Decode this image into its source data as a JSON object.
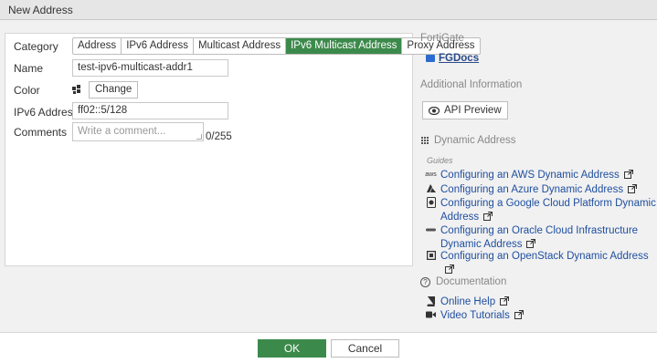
{
  "window": {
    "title": "New Address"
  },
  "form": {
    "category_label": "Category",
    "category_options": [
      "Address",
      "IPv6 Address",
      "Multicast Address",
      "IPv6 Multicast Address",
      "Proxy Address"
    ],
    "category_selected": "IPv6 Multicast Address",
    "name_label": "Name",
    "name_value": "test-ipv6-multicast-addr1",
    "color_label": "Color",
    "change_label": "Change",
    "ipv6_label": "IPv6 Address",
    "ipv6_value": "ff02::5/128",
    "comments_label": "Comments",
    "comments_placeholder": "Write a comment...",
    "comments_counter": "0/255"
  },
  "sidebar": {
    "fortigate_heading": "FortiGate",
    "fgdocs_label": "FGDocs",
    "additional_heading": "Additional Information",
    "api_preview_label": "API Preview",
    "dynamic_heading": "Dynamic Address",
    "guides_label": "Guides",
    "guides": [
      {
        "label": "Configuring an AWS Dynamic Address",
        "icon": "aws-icon"
      },
      {
        "label": "Configuring an Azure Dynamic Address",
        "icon": "azure-icon"
      },
      {
        "label": "Configuring a Google Cloud Platform Dynamic Address",
        "icon": "gcp-icon"
      },
      {
        "label": "Configuring an Oracle Cloud Infrastructure Dynamic Address",
        "icon": "oracle-icon"
      },
      {
        "label": "Configuring an OpenStack Dynamic Address",
        "icon": "openstack-icon"
      }
    ],
    "documentation_heading": "Documentation",
    "online_help_label": "Online Help",
    "video_tutorials_label": "Video Tutorials"
  },
  "footer": {
    "ok_label": "OK",
    "cancel_label": "Cancel"
  },
  "colors": {
    "accent": "#3c8a4b",
    "link": "#1f4fa0"
  }
}
